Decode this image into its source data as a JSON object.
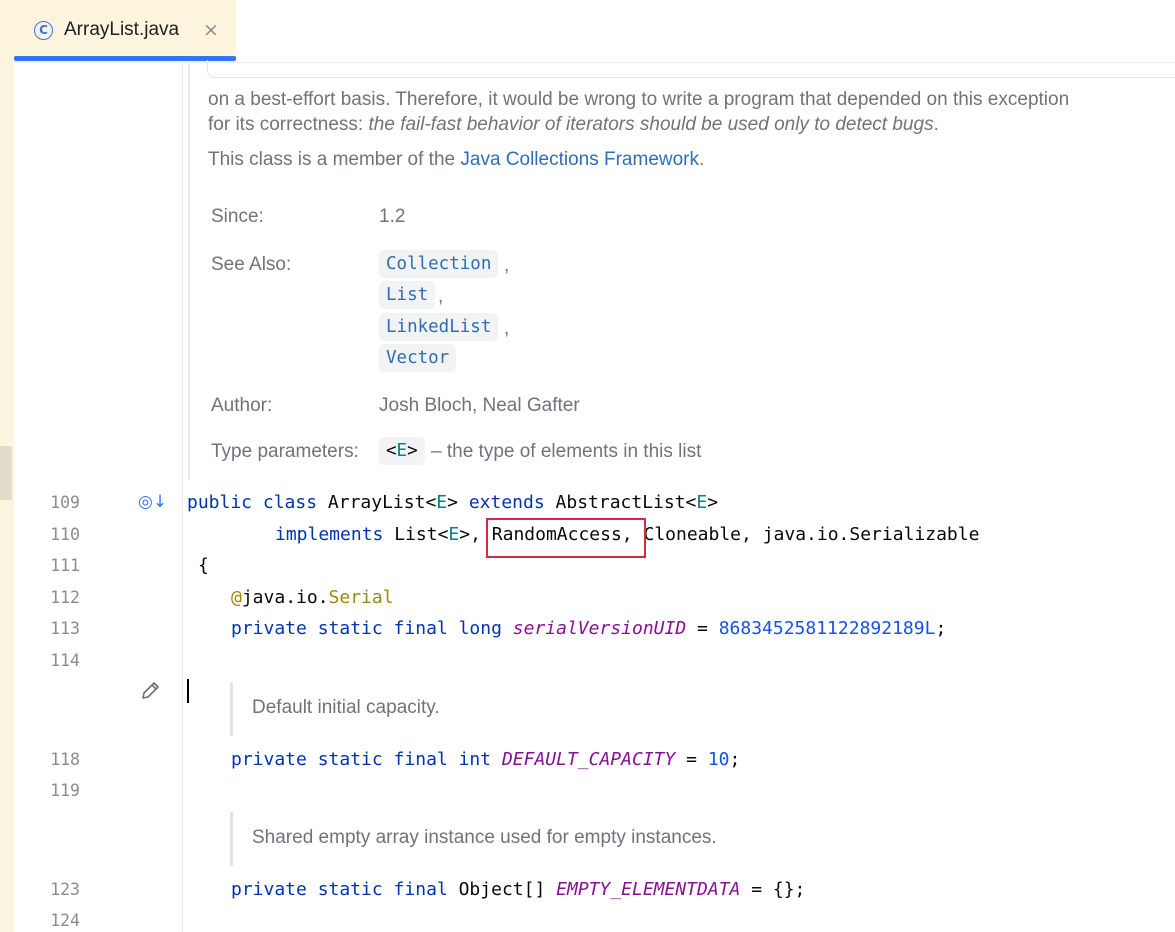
{
  "tab": {
    "icon": "class-icon",
    "icon_glyph": "C",
    "label": "ArrayList.java",
    "close_glyph": "×"
  },
  "doc": {
    "para1_line1": "on a best-effort basis. Therefore, it would be wrong to write a program that depended on this exception",
    "para1_line2_plain": "for its correctness: ",
    "para1_line2_italic": "the fail-fast behavior of iterators should be used only to detect bugs",
    "para1_line2_end": ".",
    "para2_plain": "This class is a member of the ",
    "para2_link": "Java Collections Framework",
    "para2_end": ".",
    "since_label": "Since:",
    "since_value": "1.2",
    "see_also_label": "See Also:",
    "see_also": [
      "Collection",
      "List",
      "LinkedList",
      "Vector"
    ],
    "comma": ",",
    "author_label": "Author:",
    "author_value": "Josh Bloch, Neal Gafter",
    "type_params_label": "Type parameters:",
    "type_param_open": "<",
    "type_param_name": "E",
    "type_param_close": ">",
    "type_param_desc": "– the type of elements in this list"
  },
  "gutter": {
    "line_numbers": [
      "109",
      "110",
      "111",
      "112",
      "113",
      "114",
      "118",
      "119",
      "123",
      "124"
    ],
    "implements_icon": "implementation-marker-icon",
    "implements_glyph": "◎↓",
    "edit_icon": "pencil-icon"
  },
  "code": {
    "l109": {
      "kw1": "public",
      "kw2": "class",
      "name": "ArrayList<",
      "tp": "E",
      "rest": ">",
      "kw3": "extends",
      "parent": "AbstractList<",
      "tp2": "E",
      "end": ">"
    },
    "l110": {
      "kw": "implements",
      "list": "List<",
      "tp": "E",
      "mid": ">, ",
      "highlight": "RandomAccess, ",
      "rest": "Cloneable, java.io.Serializable"
    },
    "l111": "{",
    "l112": {
      "at": "@",
      "pkg": "java.io.",
      "ann": "Serial"
    },
    "l113": {
      "mods": "private static final long",
      "field": "serialVersionUID",
      "eq": " = ",
      "value": "8683452581122892189L",
      "end": ";"
    },
    "comment1": "Default initial capacity.",
    "l118": {
      "mods": "private static final int",
      "field": "DEFAULT_CAPACITY",
      "eq": " = ",
      "value": "10",
      "end": ";"
    },
    "comment2": "Shared empty array instance used for empty instances.",
    "l123": {
      "mods": "private static final",
      "type": "Object[]",
      "field": "EMPTY_ELEMENTDATA",
      "rest": " = {};"
    }
  },
  "colors": {
    "keyword": "#0033b3",
    "type_param": "#067d8a",
    "annotation": "#9e880d",
    "static_field": "#871094",
    "number": "#1750eb",
    "link": "#2f6db5",
    "highlight_box": "#d72a3a",
    "tab_accent": "#3574f0"
  }
}
